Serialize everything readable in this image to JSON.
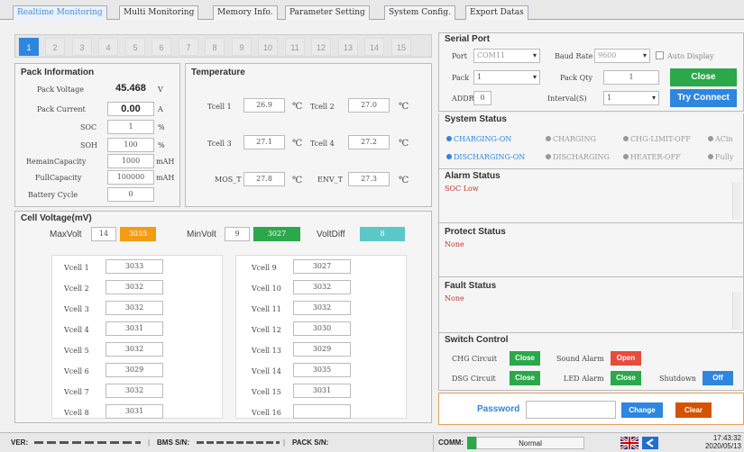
{
  "tabs": [
    "Realtime Monitoring",
    "Multi Monitoring",
    "Memory Info.",
    "Parameter Setting",
    "System Config.",
    "Export Datas"
  ],
  "pack_numbers": [
    "1",
    "2",
    "3",
    "4",
    "5",
    "6",
    "7",
    "8",
    "9",
    "10",
    "11",
    "12",
    "13",
    "14",
    "15"
  ],
  "pack_info": {
    "title": "Pack Information",
    "pack_voltage_label": "Pack Voltage",
    "pack_voltage": "45.468",
    "pack_voltage_unit": "V",
    "pack_current_label": "Pack Current",
    "pack_current": "0.00",
    "pack_current_unit": "A",
    "soc_label": "SOC",
    "soc": "1",
    "soc_unit": "%",
    "soh_label": "SOH",
    "soh": "100",
    "soh_unit": "%",
    "remain_label": "RemainCapacity",
    "remain": "1000",
    "remain_unit": "mAH",
    "full_label": "FullCapacity",
    "full": "100000",
    "full_unit": "mAH",
    "cycle_label": "Battery Cycle",
    "cycle": "0"
  },
  "temperature": {
    "title": "Temperature",
    "unit": "℃",
    "tcell1_label": "Tcell 1",
    "tcell1": "26.9",
    "tcell2_label": "Tcell 2",
    "tcell2": "27.0",
    "tcell3_label": "Tcell 3",
    "tcell3": "27.1",
    "tcell4_label": "Tcell 4",
    "tcell4": "27.2",
    "mos_label": "MOS_T",
    "mos": "27.8",
    "env_label": "ENV_T",
    "env": "27.3"
  },
  "cell_voltage": {
    "title": "Cell Voltage(mV)",
    "max_label": "MaxVolt",
    "max_index": "14",
    "max_value": "3035",
    "min_label": "MinVolt",
    "min_index": "9",
    "min_value": "3027",
    "diff_label": "VoltDiff",
    "diff_value": "8",
    "cells_left": [
      {
        "label": "Vcell 1",
        "value": "3033"
      },
      {
        "label": "Vcell 2",
        "value": "3032"
      },
      {
        "label": "Vcell 3",
        "value": "3032"
      },
      {
        "label": "Vcell 4",
        "value": "3031"
      },
      {
        "label": "Vcell 5",
        "value": "3032"
      },
      {
        "label": "Vcell 6",
        "value": "3029"
      },
      {
        "label": "Vcell 7",
        "value": "3032"
      },
      {
        "label": "Vcell 8",
        "value": "3031"
      }
    ],
    "cells_right": [
      {
        "label": "Vcell 9",
        "value": "3027"
      },
      {
        "label": "Vcell 10",
        "value": "3032"
      },
      {
        "label": "Vcell 11",
        "value": "3032"
      },
      {
        "label": "Vcell 12",
        "value": "3030"
      },
      {
        "label": "Vcell 13",
        "value": "3029"
      },
      {
        "label": "Vcell 14",
        "value": "3035"
      },
      {
        "label": "Vcell 15",
        "value": "3031"
      },
      {
        "label": "Vcell 16",
        "value": ""
      }
    ]
  },
  "serial_port": {
    "title": "Serial Port",
    "port_label": "Port",
    "port_value": "COM11",
    "baud_label": "Baud Rate",
    "baud_value": "9600",
    "auto_display_label": "Auto Display",
    "pack_label": "Pack",
    "pack_value": "1",
    "pack_qty_label": "Pack Qty",
    "pack_qty_value": "1",
    "close_label": "Close",
    "addr_label": "ADDR",
    "addr_value": "0",
    "interval_label": "Interval(S)",
    "interval_value": "1",
    "try_connect_label": "Try Connect"
  },
  "system_status": {
    "title": "System Status",
    "row1": [
      "CHARGING-ON",
      "CHARGING",
      "CHG-LIMIT-OFF",
      "ACin"
    ],
    "row2": [
      "DISCHARGING-ON",
      "DISCHARGING",
      "HEATER-OFF",
      "Fully"
    ]
  },
  "alarm_status": {
    "title": "Alarm Status",
    "text": "SOC Low"
  },
  "protect_status": {
    "title": "Protect Status",
    "text": "None"
  },
  "fault_status": {
    "title": "Fault Status",
    "text": "None"
  },
  "switch_control": {
    "title": "Switch Control",
    "chg_label": "CHG Circuit",
    "chg_btn": "Close",
    "dsg_label": "DSG Circuit",
    "dsg_btn": "Close",
    "sound_label": "Sound Alarm",
    "sound_btn": "Open",
    "led_label": "LED Alarm",
    "led_btn": "Close",
    "shutdown_label": "Shutdown",
    "shutdown_btn": "Off"
  },
  "password": {
    "label": "Password",
    "change_label": "Change",
    "clear_label": "Clear"
  },
  "statusbar": {
    "ver_label": "VER:",
    "bms_label": "BMS S/N:",
    "pack_sn_label": "PACK S/N:",
    "comm_label": "COMM:",
    "comm_status": "Normal",
    "time": "17:43:32",
    "date": "2020/05/13"
  },
  "colors": {
    "accent": "#2e86de",
    "green": "#2aa84a",
    "orange": "#f39c12",
    "red": "#e74c3c",
    "teal": "#5bc8c8"
  }
}
